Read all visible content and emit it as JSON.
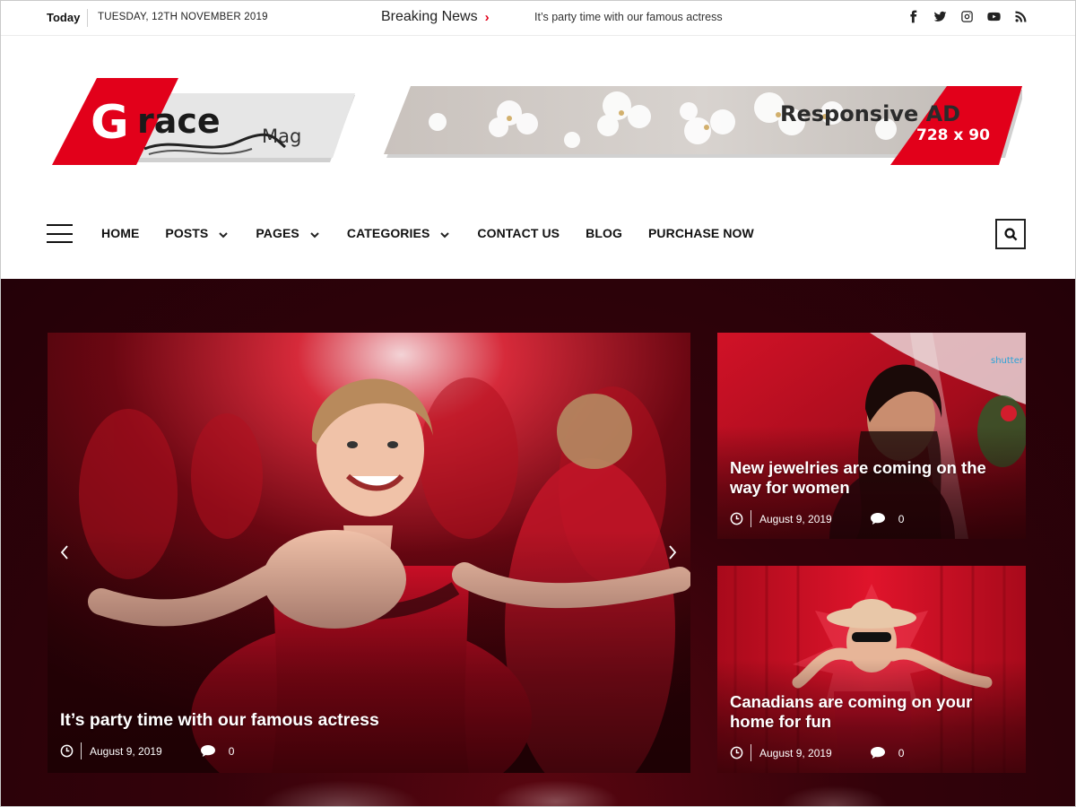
{
  "topbar": {
    "today_label": "Today",
    "date": "TUESDAY, 12TH NOVEMBER 2019",
    "breaking_label": "Breaking News",
    "ticker_text": "It’s party time with our famous actress",
    "socials": [
      "facebook-icon",
      "twitter-icon",
      "instagram-icon",
      "youtube-icon",
      "rss-icon"
    ]
  },
  "logo": {
    "big_letter": "G",
    "word": "race",
    "suffix": "Mag"
  },
  "ad": {
    "line1": "Responsive AD",
    "line2": "728 x 90"
  },
  "nav": {
    "items": [
      {
        "label": "HOME",
        "dropdown": false
      },
      {
        "label": "POSTS",
        "dropdown": true
      },
      {
        "label": "PAGES",
        "dropdown": true
      },
      {
        "label": "CATEGORIES",
        "dropdown": true
      },
      {
        "label": "CONTACT US",
        "dropdown": false
      },
      {
        "label": "BLOG",
        "dropdown": false
      },
      {
        "label": "PURCHASE NOW",
        "dropdown": false
      }
    ]
  },
  "featured": {
    "main": {
      "title": "It’s party time with our famous actress",
      "date": "August 9, 2019",
      "comments": "0"
    },
    "side": [
      {
        "title": "New jewelries are coming on the way for women",
        "date": "August 9, 2019",
        "comments": "0"
      },
      {
        "title": "Canadians are coming on your home for fun",
        "date": "August 9, 2019",
        "comments": "0"
      }
    ]
  },
  "colors": {
    "accent": "#e2001a",
    "hero_bg": "#33020a",
    "text": "#111111"
  }
}
